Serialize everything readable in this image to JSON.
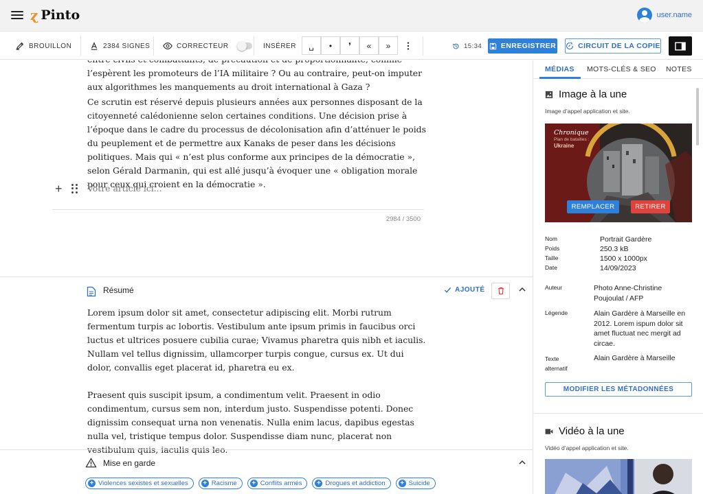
{
  "app": {
    "name": "Pinto",
    "username": "user.name"
  },
  "toolbar": {
    "draft_label": "BROUILLON",
    "chars_label": "2384 SIGNES",
    "corrector_label": "CORRECTEUR",
    "insert_label": "INSÉRER",
    "insert_buttons": [
      "␣",
      "•",
      "❜",
      "«",
      "»"
    ],
    "time": "15:34",
    "save_label": "ENREGISTRER",
    "circuit_label": "CIRCUIT DE LA COPIE"
  },
  "editor": {
    "cut_paragraph": "entre civils et combattants, de précaution et de proportionnalité, comme l’espèrent les promoteurs de l’IA militaire ? Ou au contraire, peut-on imputer aux algorithmes les manquements au droit international à Gaza ?",
    "paragraph_2": "Ce scrutin est réservé depuis plusieurs années aux personnes disposant  de la citoyenneté calédonienne selon certaines conditions. Une décision  prise à l’époque dans le cadre du processus de décolonisation afin  d’atténuer le poids du peuplement et de permettre aux Kanaks de peser  dans les décisions politiques. Mais qui « n’est plus conforme aux principes de la démocratie », selon Gérald Darmanin, qui est allé jusqu’à évoquer une « obligation morale pour ceux qui croient en la démocratie ».",
    "placeholder": "Votre article ici...",
    "char_count": "2984 / 3500"
  },
  "summary": {
    "title": "Résumé",
    "added_label": "AJOUTÉ",
    "paragraphs": [
      "Lorem ipsum dolor sit amet, consectetur adipiscing elit. Morbi rutrum fermentum turpis ac lobortis. Vestibulum ante ipsum primis in faucibus orci luctus et ultrices posuere cubilia curae; Vivamus pharetra quis nibh et iaculis. Nullam vel tellus dignissim, ullamcorper turpis congue, cursus ex. Ut dui dolor, convallis eget placerat id, pharetra eu ex.",
      "Praesent quis suscipit ipsum, a condimentum velit. Praesent in odio condimentum, cursus sem non, interdum justo. Suspendisse potenti. Donec dignissim consequat urna non venenatis. Nulla enim lacus, dapibus egestas nulla vel, tristique tempus dolor. Suspendisse diam nunc, placerat non vestibulum quis, iaculis quis leo."
    ]
  },
  "warning": {
    "title": "Mise en garde",
    "tags": [
      "Violences sexistes et sexuelles",
      "Racisme",
      "Conflits armés",
      "Drogues et addiction",
      "Suicide"
    ]
  },
  "sidebar": {
    "tabs": [
      "MÉDIAS",
      "MOTS-CLÉS & SEO",
      "NOTES"
    ],
    "featured_image": {
      "heading": "Image à la une",
      "subtitle": "Image d’appel application et site.",
      "overlay_title": "Chronique",
      "overlay_subtitle": "Plan de batailles :",
      "overlay_topic": "Ukraine",
      "replace_label": "REMPLACER",
      "remove_label": "RETIRER",
      "meta": {
        "name_label": "Nom",
        "name": "Portrait Gardère",
        "weight_label": "Poids",
        "weight": "250.3 kB",
        "size_label": "Taille",
        "size": "1500 x 1000px",
        "date_label": "Date",
        "date": "14/09/2023",
        "author_label": "Auteur",
        "author": "Photo Anne-Christine Poujoulat / AFP",
        "caption_label": "Légende",
        "caption": "Alain Gardère à Marseille en 2012. Lorem ispum dolor sit amet fluctuat nec mergit ad circae.",
        "alt_label": "Texte alternatif",
        "alt": "Alain Gardère à Marseille"
      },
      "edit_meta_label": "MODIFIER LES MÉTADONNÉES"
    },
    "featured_video": {
      "heading": "Vidéo à la une",
      "subtitle": "Vidéo d’appel application et site."
    }
  },
  "colors": {
    "accent": "#2f80d8",
    "danger": "#e0433b",
    "brand": "#e8932a"
  }
}
